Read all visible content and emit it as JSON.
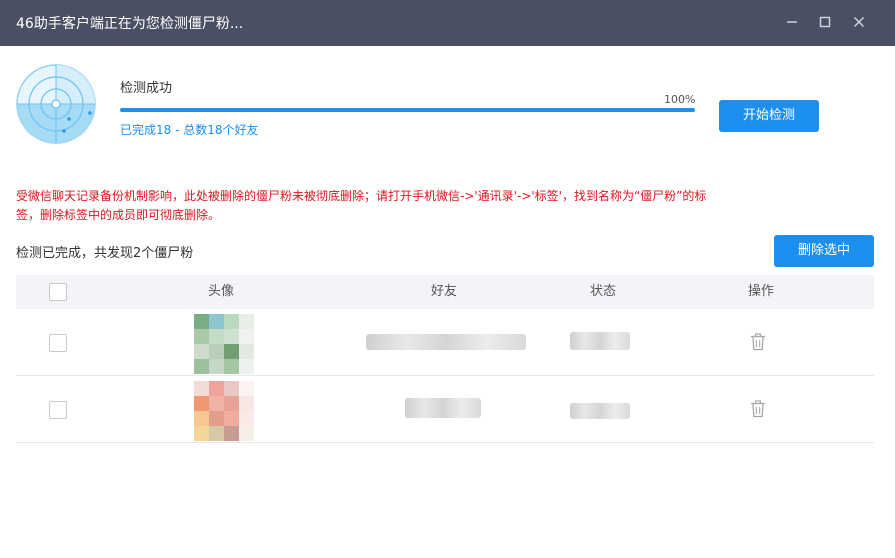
{
  "window": {
    "title": "46助手客户端正在为您检测僵尸粉...",
    "controls": [
      "minimize-icon",
      "maximize-icon",
      "close-icon"
    ]
  },
  "scan": {
    "status": "检测成功",
    "progress_percent": 100,
    "progress_text": "100%",
    "detail": "已完成18 - 总数18个好友",
    "start_button": "开始检测"
  },
  "warning": "受微信聊天记录备份机制影响，此处被删除的僵尸粉未被彻底删除；请打开手机微信->'通讯录'->'标签'，找到名称为“僵尸粉”的标签，删除标签中的成员即可彻底删除。",
  "result": {
    "summary": "检测已完成，共发现2个僵尸粉",
    "delete_button": "删除选中"
  },
  "table": {
    "headers": {
      "avatar": "头像",
      "friend": "好友",
      "status": "状态",
      "action": "操作"
    },
    "rows": [
      {
        "checked": false,
        "avatar_colors": [
          "#7aad84",
          "#8ec6cf",
          "#bcd9c0",
          "#e6eee6",
          "#a9c9a9",
          "#c4dcc3",
          "#cfe2cf",
          "#f1f1f1",
          "#cfdccd",
          "#b9cdb8",
          "#6f9f73",
          "#e2e8e2",
          "#9dc09c",
          "#c5d7c4",
          "#a5c6a3",
          "#eef2ee"
        ],
        "action_icon": "trash-icon"
      },
      {
        "checked": false,
        "avatar_colors": [
          "#f2dcd8",
          "#f0a39c",
          "#e9c7c2",
          "#fbf2f1",
          "#f09774",
          "#f0b1a7",
          "#e8a396",
          "#f7e6e3",
          "#f5c794",
          "#e39e8b",
          "#f0ad9d",
          "#fae9e6",
          "#f3d598",
          "#d8c9a6",
          "#c79b91",
          "#f6efe8"
        ],
        "action_icon": "trash-icon"
      }
    ]
  },
  "colors": {
    "accent": "#1d8fef",
    "titlebar": "#4a4f63",
    "warning": "#e0141e"
  }
}
